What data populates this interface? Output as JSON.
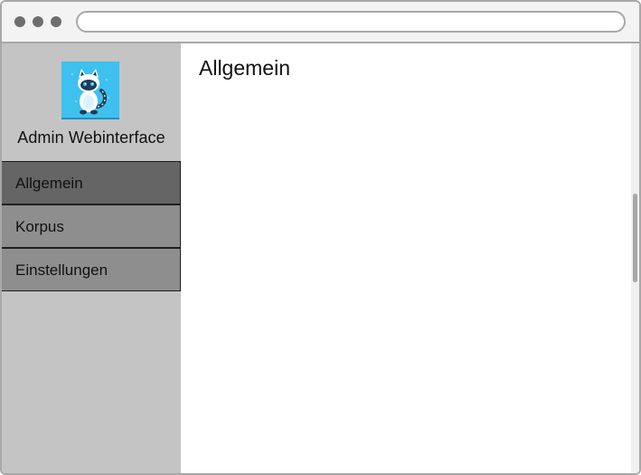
{
  "app": {
    "title": "Admin Webinterface"
  },
  "sidebar": {
    "items": [
      {
        "label": "Allgemein",
        "active": true
      },
      {
        "label": "Korpus",
        "active": false
      },
      {
        "label": "Einstellungen",
        "active": false
      }
    ]
  },
  "main": {
    "title": "Allgemein"
  },
  "icons": {
    "logo": "cat-logo-icon",
    "window_controls": [
      "window-dot-icon",
      "window-dot-icon",
      "window-dot-icon"
    ]
  },
  "colors": {
    "sidebar_bg": "#c4c4c4",
    "nav_item_bg": "#8e8e8e",
    "nav_item_active_bg": "#656565",
    "logo_bg": "#3ec1ee"
  }
}
